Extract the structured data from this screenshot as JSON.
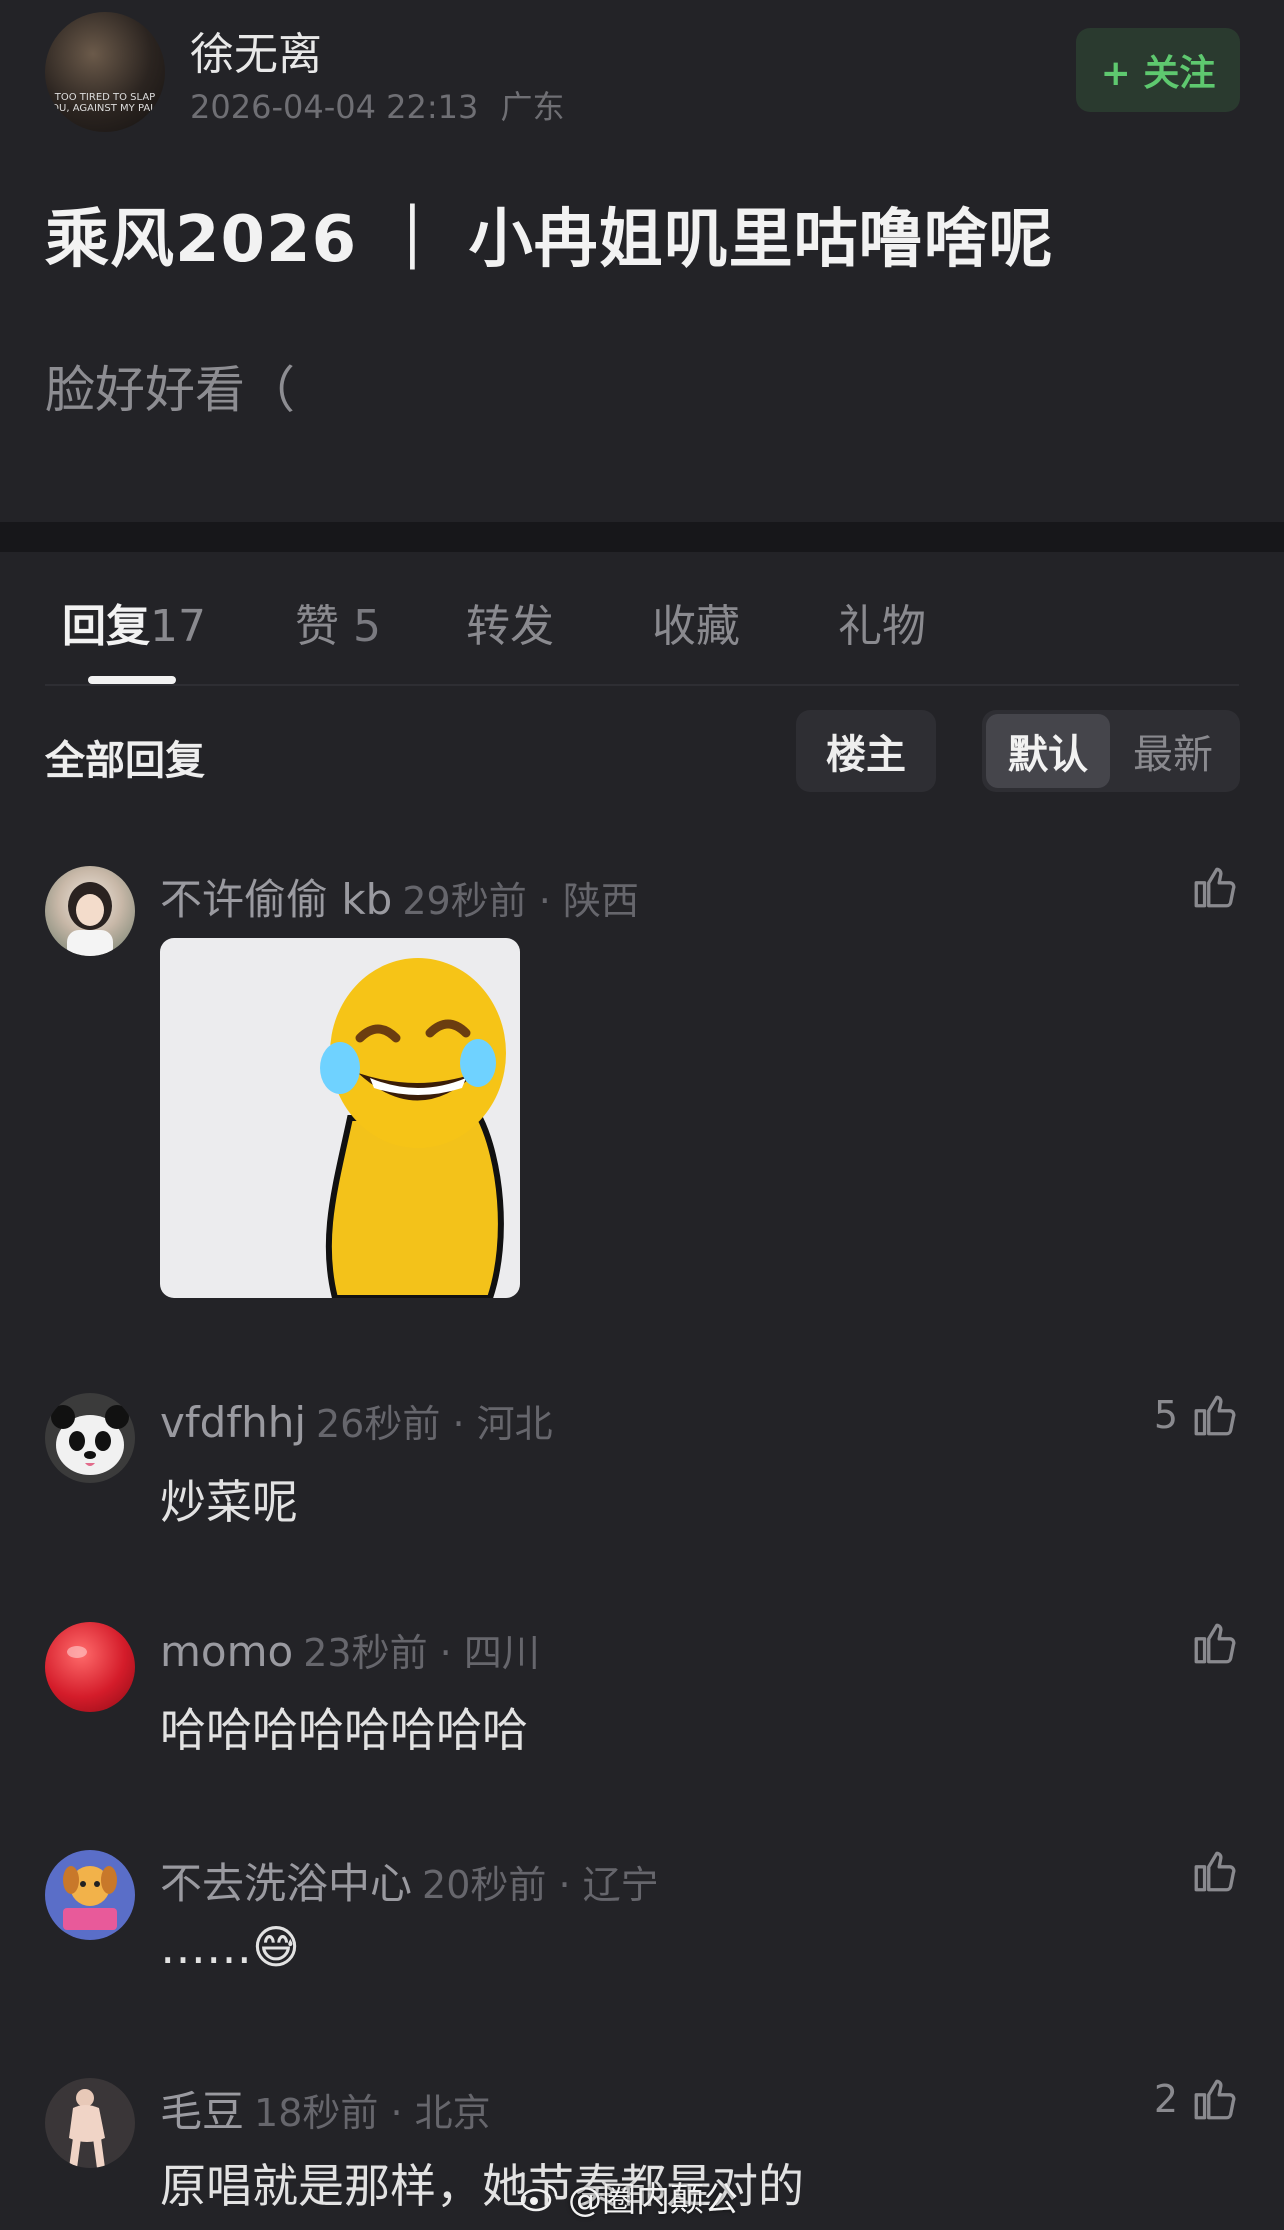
{
  "post": {
    "author": "徐无离",
    "avatar_caption": "TOO TIRED TO SLAP YOU, AGAINST MY PALM",
    "timestamp": "2026-04-04 22:13",
    "location": "广东",
    "follow_label": "+ 关注",
    "title": "乘风2026 ｜ 小冉姐叽里咕噜啥呢",
    "body": "脸好好看（"
  },
  "tabs": [
    {
      "label": "回复",
      "count": "17"
    },
    {
      "label": "赞",
      "count": "5"
    },
    {
      "label": "转发",
      "count": ""
    },
    {
      "label": "收藏",
      "count": ""
    },
    {
      "label": "礼物",
      "count": ""
    }
  ],
  "filter": {
    "all_replies": "全部回复",
    "op_label": "楼主",
    "sort_default": "默认",
    "sort_latest": "最新"
  },
  "comments": [
    {
      "user": "不许偷偷 kb",
      "time": "29秒前",
      "location": "陕西",
      "text": "",
      "likes": "",
      "has_sticker": true
    },
    {
      "user": "vfdfhhj",
      "time": "26秒前",
      "location": "河北",
      "text": "炒菜呢",
      "likes": "5"
    },
    {
      "user": "momo",
      "time": "23秒前",
      "location": "四川",
      "text": "哈哈哈哈哈哈哈哈",
      "likes": ""
    },
    {
      "user": "不去洗浴中心",
      "time": "20秒前",
      "location": "辽宁",
      "text": "……😅",
      "likes": ""
    },
    {
      "user": "毛豆",
      "time": "18秒前",
      "location": "北京",
      "text": "原唱就是那样，她节奏都是对的",
      "likes": "2"
    }
  ],
  "watermark": "@圈内颠公",
  "colors": {
    "accent_green": "#5ec86f",
    "background": "#232327"
  }
}
